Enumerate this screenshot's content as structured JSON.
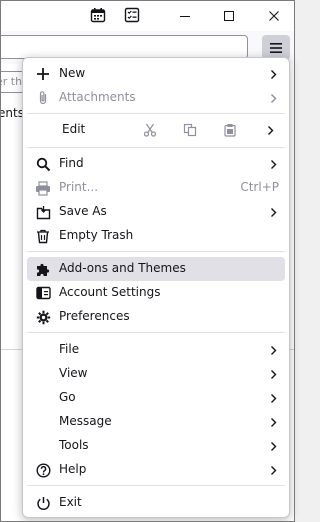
{
  "titlebar": {
    "icons": [
      "calendar-icon",
      "tasks-icon"
    ],
    "controls": [
      "minimize-icon",
      "maximize-icon",
      "close-icon"
    ]
  },
  "toolbar": {
    "menu_icon": "hamburger-menu-icon"
  },
  "filterbar": {
    "placeholder_fragment": "er th"
  },
  "content": {
    "list_text_fragment": "ents"
  },
  "menu": {
    "new": {
      "label": "New",
      "icon": "plus-icon"
    },
    "attachments": {
      "label": "Attachments",
      "icon": "paperclip-icon"
    },
    "edit": {
      "label": "Edit",
      "buttons": [
        "cut-icon",
        "copy-icon",
        "paste-icon"
      ]
    },
    "find": {
      "label": "Find",
      "icon": "search-icon"
    },
    "print": {
      "label": "Print...",
      "icon": "printer-icon",
      "shortcut": "Ctrl+P"
    },
    "save_as": {
      "label": "Save As",
      "icon": "save-as-icon"
    },
    "empty_trash": {
      "label": "Empty Trash",
      "icon": "trash-icon"
    },
    "addons": {
      "label": "Add-ons and Themes",
      "icon": "puzzle-icon"
    },
    "account_settings": {
      "label": "Account Settings",
      "icon": "account-settings-icon"
    },
    "preferences": {
      "label": "Preferences",
      "icon": "gear-icon"
    },
    "file": {
      "label": "File"
    },
    "view": {
      "label": "View"
    },
    "go": {
      "label": "Go"
    },
    "message": {
      "label": "Message"
    },
    "tools": {
      "label": "Tools"
    },
    "help": {
      "label": "Help",
      "icon": "help-icon"
    },
    "exit": {
      "label": "Exit",
      "icon": "power-icon"
    }
  },
  "colors": {
    "menu_bg": "#ffffff",
    "highlight_bg": "#e0e0e6",
    "disabled_text": "#8f8f9d",
    "text": "#15141a",
    "hamburger_active_bg": "#cfcfd8"
  }
}
